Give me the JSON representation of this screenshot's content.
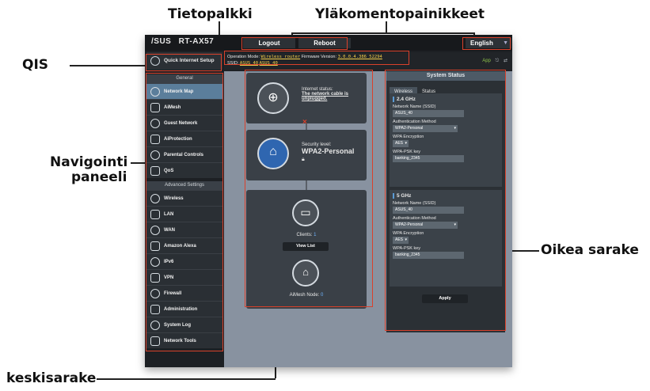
{
  "annotations": {
    "tietopalkki": "Tietopalkki",
    "ylakomento": "Yläkomentopainikkeet",
    "qis": "QIS",
    "navigointi_1": "Navigointi",
    "navigointi_2": "paneeli",
    "oikea": "Oikea sarake",
    "keski": "keskisarake"
  },
  "window": {
    "brand": "/SUS",
    "model": "RT-AX57",
    "logout": "Logout",
    "reboot": "Reboot",
    "language": "English"
  },
  "qis": {
    "label": "Quick Internet Setup"
  },
  "infobar": {
    "op_mode_label": "Operation Mode:",
    "op_mode_value": "Wireless router",
    "fw_label": "Firmware Version:",
    "fw_value": "3.0.0.4.386_52294",
    "ssid_label": "SSID:",
    "ssid_1": "ASUS_40",
    "ssid_2": "ASUS_40",
    "app_label": "App"
  },
  "sidebar": {
    "general_header": "General",
    "general": [
      {
        "label": "Network Map",
        "icon": "network-map-icon",
        "active": true
      },
      {
        "label": "AiMesh",
        "icon": "aimesh-icon"
      },
      {
        "label": "Guest Network",
        "icon": "globe-icon"
      },
      {
        "label": "AiProtection",
        "icon": "shield-icon"
      },
      {
        "label": "Parental Controls",
        "icon": "parental-icon"
      },
      {
        "label": "QoS",
        "icon": "speedometer-icon"
      }
    ],
    "advanced_header": "Advanced Settings",
    "advanced": [
      {
        "label": "Wireless",
        "icon": "wireless-icon"
      },
      {
        "label": "LAN",
        "icon": "lan-icon"
      },
      {
        "label": "WAN",
        "icon": "wan-icon"
      },
      {
        "label": "Amazon Alexa",
        "icon": "alexa-icon"
      },
      {
        "label": "IPv6",
        "icon": "ipv6-icon"
      },
      {
        "label": "VPN",
        "icon": "vpn-icon"
      },
      {
        "label": "Firewall",
        "icon": "firewall-icon"
      },
      {
        "label": "Administration",
        "icon": "administration-icon"
      },
      {
        "label": "System Log",
        "icon": "system-log-icon"
      },
      {
        "label": "Network Tools",
        "icon": "network-tools-icon"
      }
    ]
  },
  "middle": {
    "internet_label": "Internet status:",
    "internet_value": "The network cable is unplugged.",
    "security_label": "Security level:",
    "security_value": "WPA2-Personal",
    "clients_label": "Clients:",
    "clients_count": "1",
    "view_list": "View List",
    "aimesh_label": "AiMesh Node:",
    "aimesh_count": "0"
  },
  "system_status": {
    "title": "System Status",
    "tab_wireless": "Wireless",
    "tab_status": "Status",
    "band_24": "2.4 GHz",
    "band_5": "5 GHz",
    "ssid_label": "Network Name (SSID)",
    "ssid_24": "ASUS_40",
    "ssid_5": "ASUS_40",
    "auth_label": "Authentication Method",
    "auth_24": "WPA2-Personal",
    "auth_5": "WPA2-Personal",
    "enc_label": "WPA Encryption",
    "enc_24": "AES",
    "enc_5": "AES",
    "key_label": "WPA-PSK key",
    "key_24": "banking_2345",
    "key_5": "banking_2345",
    "apply": "Apply"
  }
}
